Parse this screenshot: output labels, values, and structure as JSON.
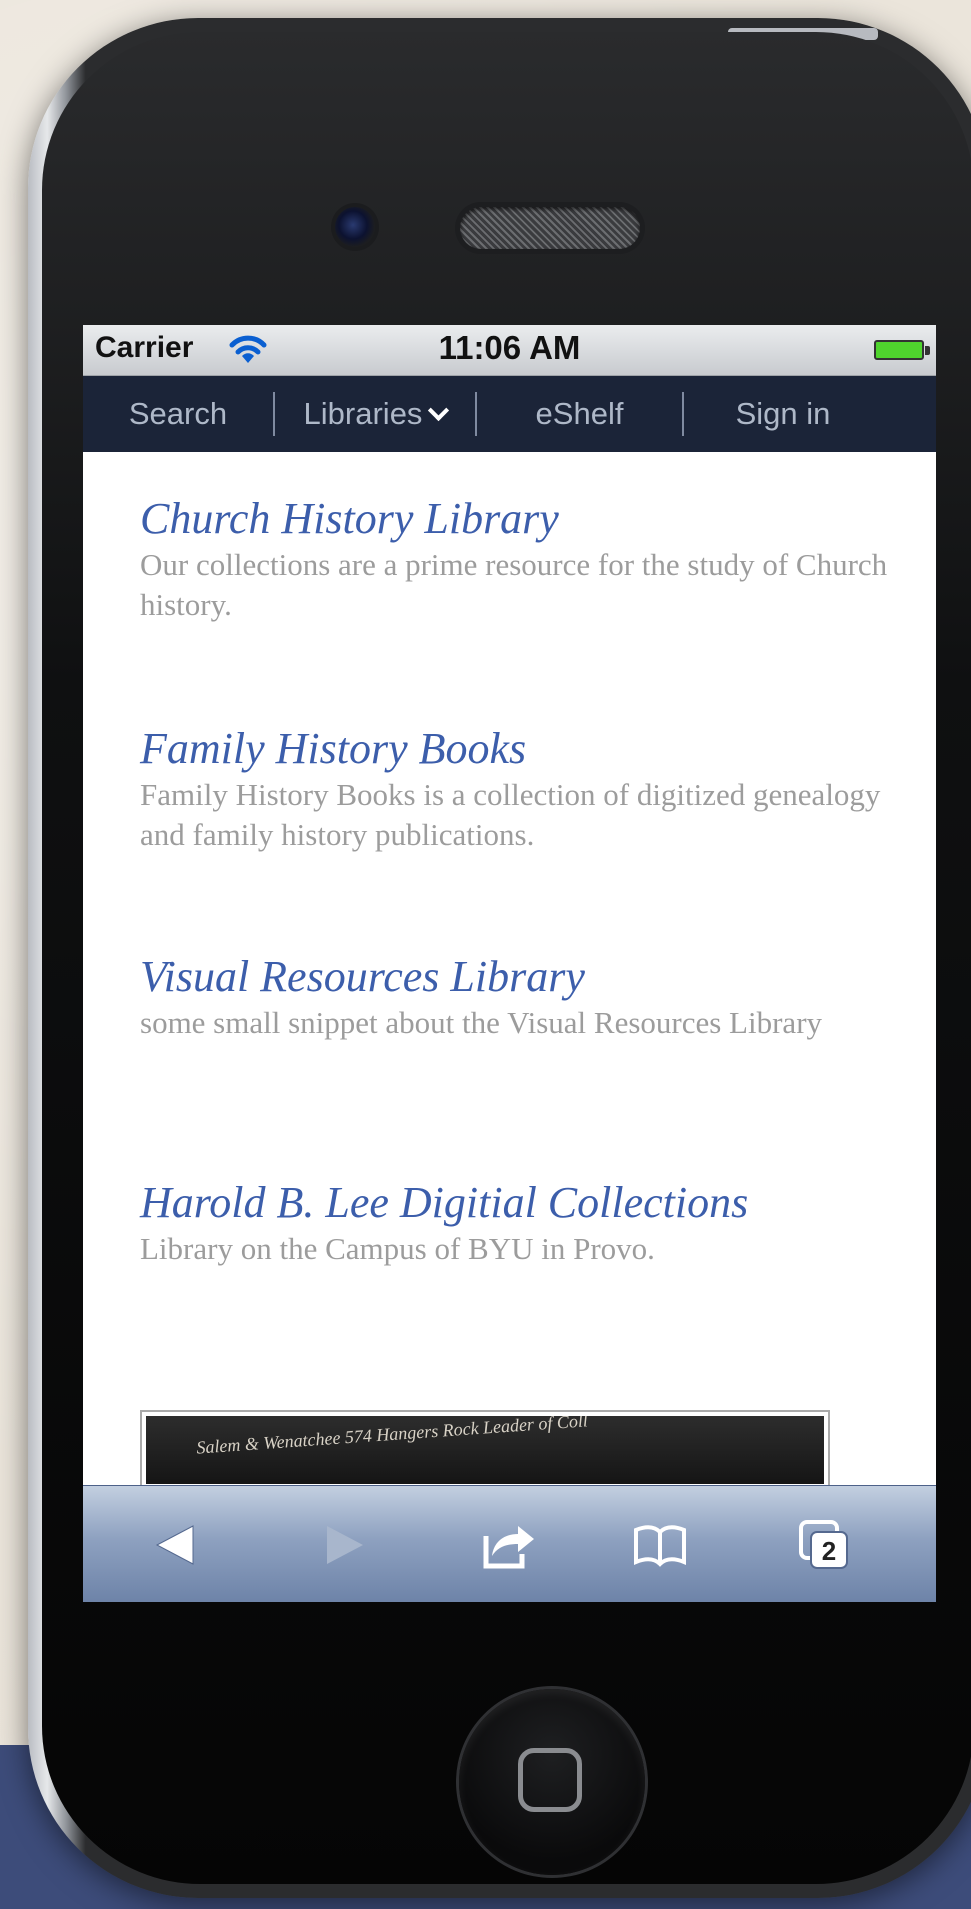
{
  "status_bar": {
    "carrier": "Carrier",
    "time": "11:06 AM"
  },
  "nav": {
    "items": [
      {
        "label": "Search"
      },
      {
        "label": "Libraries"
      },
      {
        "label": "eShelf"
      },
      {
        "label": "Sign in"
      }
    ]
  },
  "libraries": [
    {
      "title": "Church History Library",
      "description": "Our collections are a prime resource for the study of Church history."
    },
    {
      "title": "Family History Books",
      "description": "Family History Books is a collection of digitized genealogy and family history publications."
    },
    {
      "title": "Visual Resources Library",
      "description": "some small snippet about the Visual Resources Library"
    },
    {
      "title": "Harold B. Lee Digitial Collections",
      "description": "Library on the Campus of BYU in Provo."
    }
  ],
  "thumbnail": {
    "handwriting": "Salem & Wenatchee   574   Hangers Rock   Leader of Coll"
  },
  "toolbar": {
    "tabs_count": "2",
    "icons": [
      "back-icon",
      "forward-icon",
      "share-icon",
      "bookmarks-icon",
      "tabs-icon"
    ]
  },
  "colors": {
    "link_blue": "#3c5eab",
    "desc_gray": "#9c9c9c",
    "nav_bg": "#1b2438",
    "backdrop_band": "#3d4c7a"
  }
}
